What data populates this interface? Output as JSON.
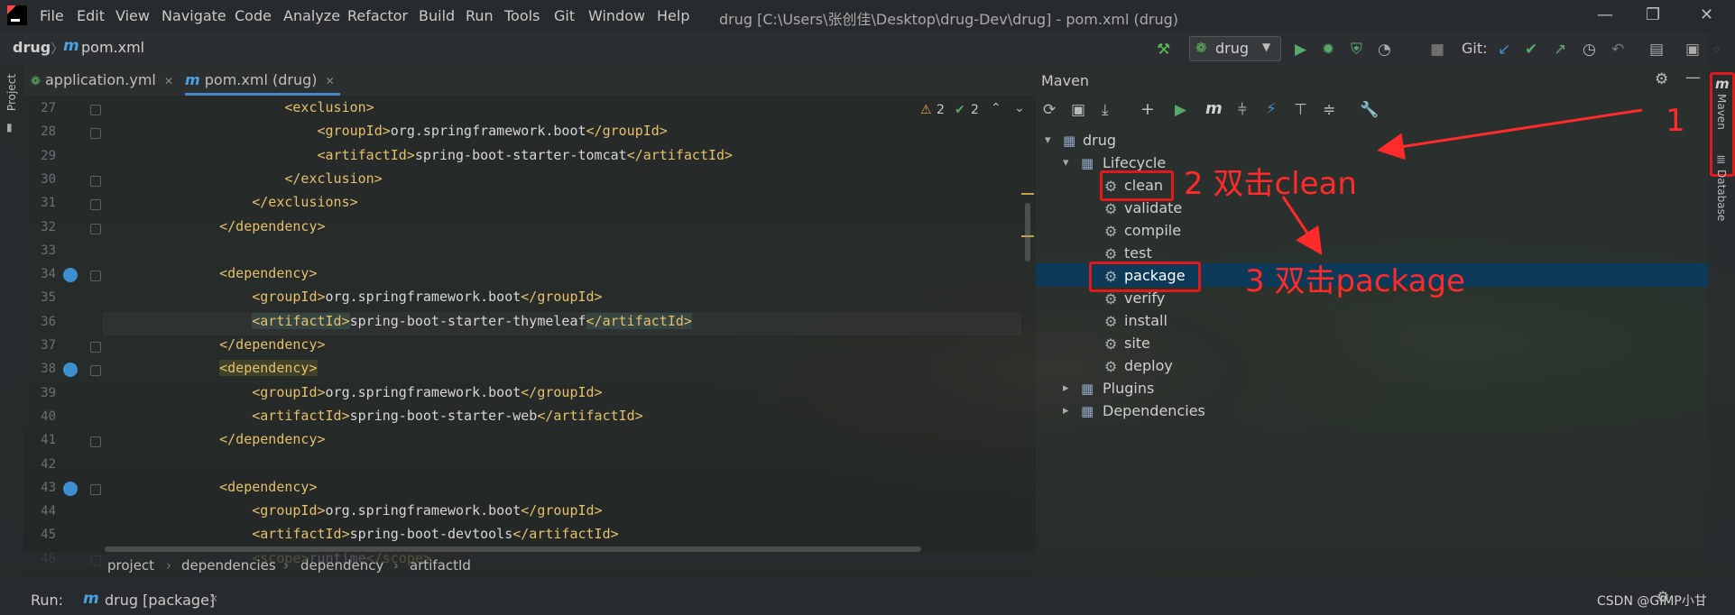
{
  "menu": [
    "File",
    "Edit",
    "View",
    "Navigate",
    "Code",
    "Analyze",
    "Refactor",
    "Build",
    "Run",
    "Tools",
    "Git",
    "Window",
    "Help"
  ],
  "window_title": "drug [C:\\Users\\张创佳\\Desktop\\drug-Dev\\drug] - pom.xml (drug)",
  "nav": {
    "project": "drug",
    "file": "pom.xml",
    "run_config": "drug",
    "git_label": "Git:"
  },
  "tabs": [
    {
      "label": "application.yml"
    },
    {
      "label": "pom.xml (drug)"
    }
  ],
  "left_strip": {
    "project": "Project"
  },
  "inspections": {
    "warnings": "2",
    "ok": "2"
  },
  "code_lines": [
    {
      "n": "27",
      "indent": "            ",
      "open": "<exclusion>",
      "text": "",
      "close": ""
    },
    {
      "n": "28",
      "indent": "                ",
      "open": "<groupId>",
      "text": "org.springframework.boot",
      "close": "</groupId>"
    },
    {
      "n": "29",
      "indent": "                ",
      "open": "<artifactId>",
      "text": "spring-boot-starter-tomcat",
      "close": "</artifactId>"
    },
    {
      "n": "30",
      "indent": "            ",
      "open": "</exclusion>",
      "text": "",
      "close": ""
    },
    {
      "n": "31",
      "indent": "        ",
      "open": "</exclusions>",
      "text": "",
      "close": ""
    },
    {
      "n": "32",
      "indent": "    ",
      "open": "</dependency>",
      "text": "",
      "close": ""
    },
    {
      "n": "33",
      "indent": "",
      "open": "",
      "text": "",
      "close": ""
    },
    {
      "n": "34",
      "indent": "    ",
      "open": "<dependency>",
      "text": "",
      "close": ""
    },
    {
      "n": "35",
      "indent": "        ",
      "open": "<groupId>",
      "text": "org.springframework.boot",
      "close": "</groupId>"
    },
    {
      "n": "36",
      "indent": "        ",
      "open": "<artifactId>",
      "text": "spring-boot-starter-thymeleaf",
      "close": "</artifactId>"
    },
    {
      "n": "37",
      "indent": "    ",
      "open": "</dependency>",
      "text": "",
      "close": ""
    },
    {
      "n": "38",
      "indent": "    ",
      "open": "<dependency>",
      "text": "",
      "close": ""
    },
    {
      "n": "39",
      "indent": "        ",
      "open": "<groupId>",
      "text": "org.springframework.boot",
      "close": "</groupId>"
    },
    {
      "n": "40",
      "indent": "        ",
      "open": "<artifactId>",
      "text": "spring-boot-starter-web",
      "close": "</artifactId>"
    },
    {
      "n": "41",
      "indent": "    ",
      "open": "</dependency>",
      "text": "",
      "close": ""
    },
    {
      "n": "42",
      "indent": "",
      "open": "",
      "text": "",
      "close": ""
    },
    {
      "n": "43",
      "indent": "    ",
      "open": "<dependency>",
      "text": "",
      "close": ""
    },
    {
      "n": "44",
      "indent": "        ",
      "open": "<groupId>",
      "text": "org.springframework.boot",
      "close": "</groupId>"
    },
    {
      "n": "45",
      "indent": "        ",
      "open": "<artifactId>",
      "text": "spring-boot-devtools",
      "close": "</artifactId>"
    },
    {
      "n": "46",
      "indent": "        ",
      "open": "<scope>",
      "text": "runtime",
      "close": "</scope>"
    }
  ],
  "breadcrumb": [
    "project",
    "dependencies",
    "dependency",
    "artifactId"
  ],
  "maven": {
    "title": "Maven",
    "root": "drug",
    "lifecycle": "Lifecycle",
    "phases": [
      "clean",
      "validate",
      "compile",
      "test",
      "package",
      "verify",
      "install",
      "site",
      "deploy"
    ],
    "plugins": "Plugins",
    "dependencies": "Dependencies",
    "selected": "package"
  },
  "right_strip": {
    "maven": "Maven",
    "database": "Database"
  },
  "annotations": {
    "step1": "1",
    "step2": "2 双击clean",
    "step3": "3 双击package"
  },
  "run_bar": {
    "label": "Run:",
    "config": "drug [package]"
  },
  "watermark": "CSDN @GIMP小甘",
  "colors": {
    "annotation_red": "#e01a1a",
    "selection_blue": "#0d3a58",
    "xml_tag": "#e8bf6a"
  }
}
